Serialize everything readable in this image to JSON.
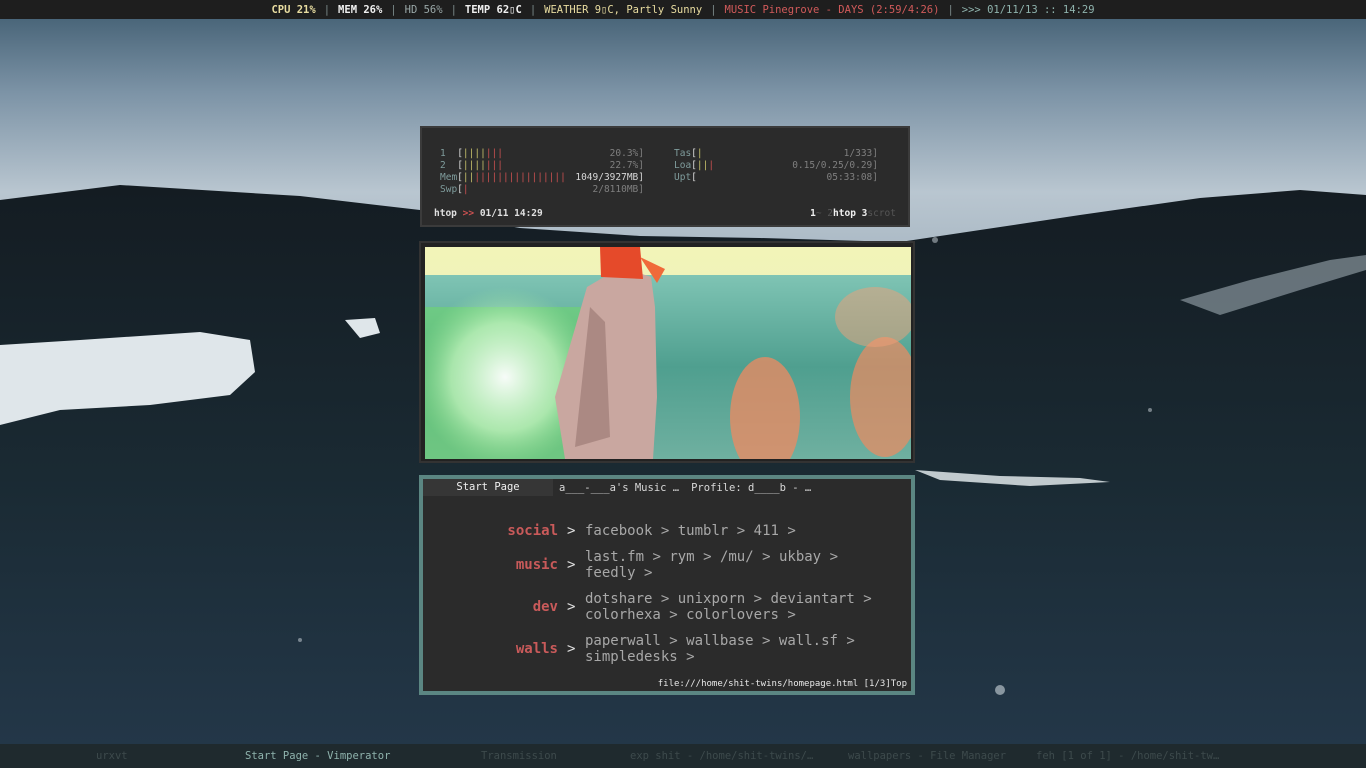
{
  "topbar": {
    "cpu": "CPU 21%",
    "mem": "MEM 26%",
    "hd": "HD 56%",
    "temp": "TEMP 62▯C",
    "weather": "WEATHER 9▯C, Partly Sunny",
    "music": "MUSIC Pinegrove - DAYS (2:59/4:26)",
    "datetime": ">>> 01/11/13 :: 14:29",
    "separator": "|"
  },
  "htop": {
    "cpu1_label": "1",
    "cpu1_value": "20.3%]",
    "cpu2_label": "2",
    "cpu2_value": "22.7%]",
    "mem_label": "Mem",
    "mem_value": "1049/3927MB]",
    "swp_label": "Swp",
    "swp_value": "2/8110MB]",
    "tasks_label": "Tas",
    "tasks_value": "1/333]",
    "load_label": "Loa",
    "load_value": "0.15/0.25/0.29]",
    "uptime_label": "Upt",
    "uptime_value": "05:33:08]",
    "status_name": "htop",
    "status_arrow": ">>",
    "status_date": "01/11 14:29",
    "tags": [
      {
        "num": "1",
        "label": "~",
        "active": true
      },
      {
        "num": "2",
        "label": "htop",
        "active": true
      },
      {
        "num": "3",
        "label": "scrot",
        "active": false
      }
    ]
  },
  "browser": {
    "tabs": [
      {
        "label": "Start Page",
        "active": true
      },
      {
        "label": "a___-___a's Music …",
        "active": false
      },
      {
        "label": "Profile: d____b - …",
        "active": false
      }
    ],
    "categories": [
      {
        "name": "social",
        "links": [
          "facebook",
          "tumblr",
          "411"
        ]
      },
      {
        "name": "music",
        "links": [
          "last.fm",
          "rym",
          "/mu/",
          "ukbay",
          "feedly"
        ]
      },
      {
        "name": "dev",
        "links": [
          "dotshare",
          "unixporn",
          "deviantart",
          "colorhexa",
          "colorlovers"
        ]
      },
      {
        "name": "walls",
        "links": [
          "paperwall",
          "wallbase",
          "wall.sf",
          "simpledesks"
        ]
      }
    ],
    "arrow": ">",
    "status_url": "file:///home/shit-twins/homepage.html",
    "status_pos": "[1/3]Top"
  },
  "taskbar": [
    {
      "label": "urxvt",
      "active": false
    },
    {
      "label": "Start Page - Vimperator",
      "active": true
    },
    {
      "label": "Transmission",
      "active": false
    },
    {
      "label": "exp shit - /home/shit-twins/…",
      "active": false
    },
    {
      "label": "wallpapers - File Manager",
      "active": false
    },
    {
      "label": "feh [1 of 1] - /home/shit-tw…",
      "active": false
    }
  ]
}
